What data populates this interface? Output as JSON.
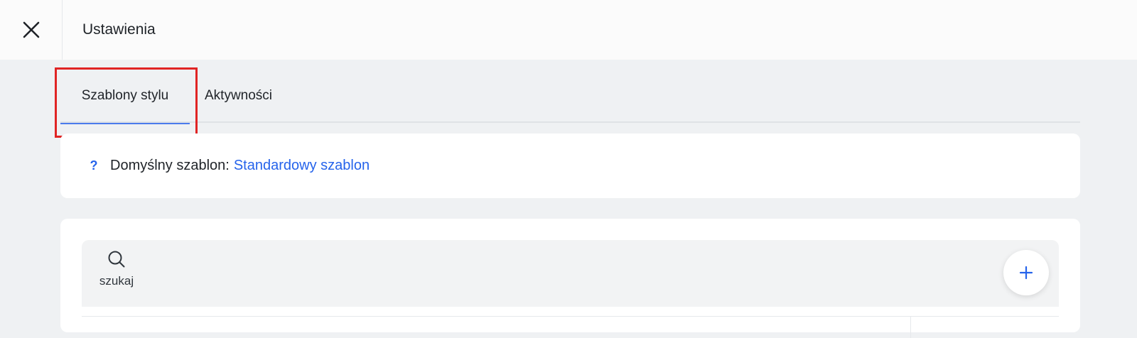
{
  "header": {
    "title": "Ustawienia",
    "close_icon": "close-icon"
  },
  "tabs": [
    {
      "label": "Szablony stylu",
      "active": true
    },
    {
      "label": "Aktywności",
      "active": false
    }
  ],
  "info": {
    "help_icon": "?",
    "text": "Domyślny szablon:",
    "link": "Standardowy szablon"
  },
  "toolbar": {
    "search_label": "szukaj",
    "search_icon": "search-icon",
    "add_icon": "plus-icon"
  },
  "colors": {
    "accent": "#2563eb",
    "highlight": "#e02424",
    "background": "#eff1f3"
  }
}
